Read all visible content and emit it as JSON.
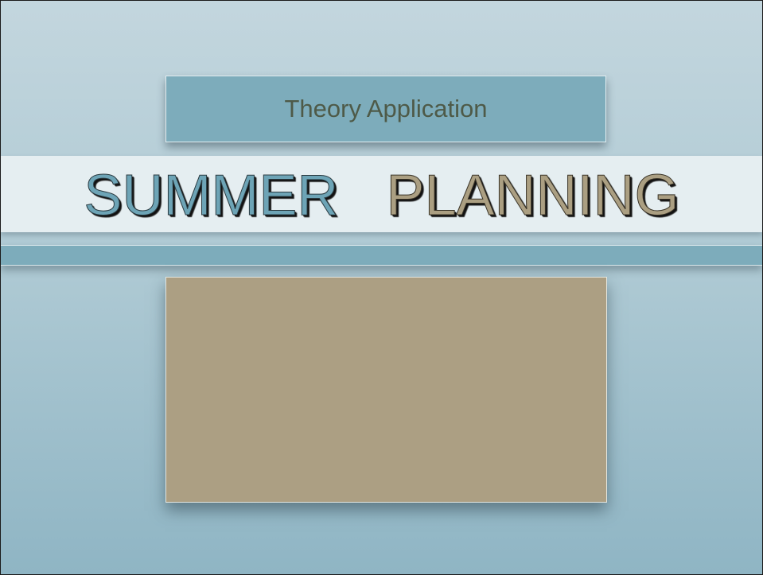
{
  "slide": {
    "subtitle": "Theory Application",
    "title_word_1": "SUMMER",
    "title_word_2": "PLANNING",
    "colors": {
      "background_top": "#c3d6de",
      "background_bottom": "#8fb5c4",
      "teal_accent": "#7dacbb",
      "tan_accent": "#ac9f83",
      "title_band": "#e5eef1"
    }
  }
}
